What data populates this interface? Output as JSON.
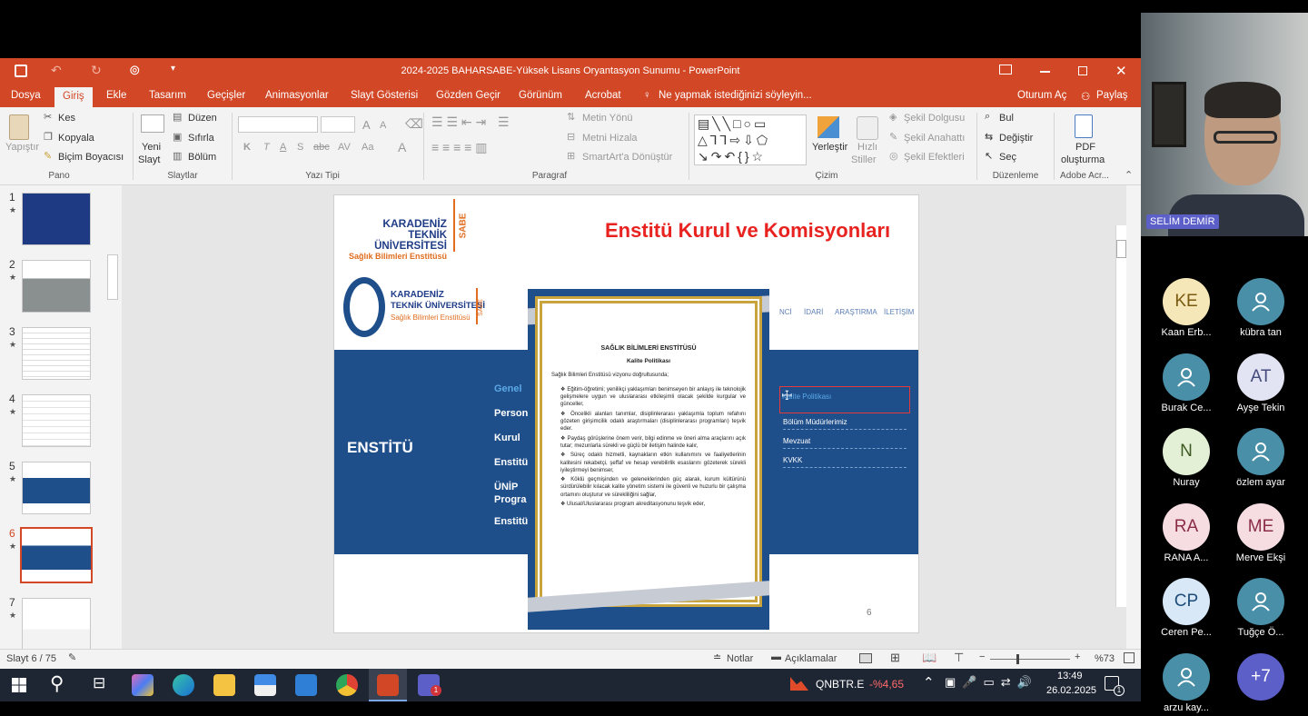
{
  "window": {
    "title": "2024-2025 BAHARSABE-Yüksek Lisans Oryantasyon Sunumu - PowerPoint"
  },
  "menu": {
    "tabs": [
      "Dosya",
      "Giriş",
      "Ekle",
      "Tasarım",
      "Geçişler",
      "Animasyonlar",
      "Slayt Gösterisi",
      "Gözden Geçir",
      "Görünüm",
      "Acrobat"
    ],
    "tell_me": "Ne yapmak istediğinizi söyleyin...",
    "sign_in": "Oturum Aç",
    "share": "Paylaş"
  },
  "ribbon": {
    "pano": {
      "label": "Pano",
      "paste": "Yapıştır",
      "cut": "Kes",
      "copy": "Kopyala",
      "format_painter": "Biçim Boyacısı"
    },
    "slaytlar": {
      "label": "Slaytlar",
      "new_slide_1": "Yeni",
      "new_slide_2": "Slayt",
      "layout": "Düzen",
      "reset": "Sıfırla",
      "section": "Bölüm"
    },
    "yazi_tipi": {
      "label": "Yazı Tipi",
      "b": "K",
      "i": "T",
      "u": "A",
      "s": "S",
      "abc": "abc",
      "av": "AV",
      "aa": "Aa",
      "a": "A",
      "grow": "A",
      "shrink": "A"
    },
    "paragraf": {
      "label": "Paragraf",
      "text_dir": "Metin Yönü",
      "align_text": "Metni Hizala",
      "smartart": "SmartArt'a Dönüştür"
    },
    "cizim": {
      "label": "Çizim",
      "arrange": "Yerleştir",
      "quick_styles_1": "Hızlı",
      "quick_styles_2": "Stiller",
      "fill": "Şekil Dolgusu",
      "outline": "Şekil Anahattı",
      "effects": "Şekil Efektleri"
    },
    "duzenleme": {
      "label": "Düzenleme",
      "find": "Bul",
      "replace": "Değiştir",
      "select": "Seç"
    },
    "adobe": {
      "label": "Adobe Acr...",
      "pdf_1": "PDF",
      "pdf_2": "oluşturma"
    }
  },
  "thumbnails": [
    "1",
    "2",
    "3",
    "4",
    "5",
    "6",
    "7"
  ],
  "slide": {
    "uni_line1": "KARADENİZ",
    "uni_line2": "TEKNİK ÜNİVERSİTESİ",
    "institute": "Sağlık Bilimleri Enstitüsü",
    "sabe": "SABE",
    "title": "Enstitü Kurul ve Komisyonları",
    "nav": [
      "NCİ",
      "İDARİ",
      "ARAŞTIRMA",
      "İLETİŞİM"
    ],
    "enstitu": "ENSTİTÜ",
    "left_menu": [
      "Genel",
      "Person",
      "Kurul",
      "Enstitü",
      "ÜNİP",
      "Progra",
      "Enstitü"
    ],
    "right_menu": [
      "Kalite Politikası",
      "Bölüm Müdürlerimiz",
      "Mevzuat",
      "KVKK"
    ],
    "page_number": "6",
    "popup": {
      "heading": "SAĞLIK BİLİMLERİ ENSTİTÜSÜ",
      "subheading": "Kalite Politikası",
      "intro": "Sağlık Bilimleri Enstitüsü vizyonu doğrultusunda;",
      "bullets": [
        "Eğitim-öğretimi; yenilikçi yaklaşımları benimseyen bir anlayış ile teknolojik gelişmelere uygun ve uluslararası etkileşimli olacak şekilde kurgular ve günceller,",
        "Öncelikli alanları tanımlar, disiplinlerarası yaklaşımla toplum refahını gözeten girişimcilik odaklı araştırmaları (disiplinlerarası programları) teşvik eder.",
        "Paydaş görüşlerine önem verir, bilgi edinme ve öneri alma araçlarını açık tutar; mezunlarla sürekli ve güçlü bir iletişim halinde kalır,",
        "Süreç odaklı hizmetli, kaynakların etkin kullanımını ve faaliyetlerinin kalitesini rekabetçi, şeffaf ve hesap verebilirlik esaslarını gözeterek sürekli iyileştirmeyi benimser,",
        "Köklü geçmişinden ve geleneklerinden güç alarak, kurum kültürünü sürdürülebilir kılacak kalite yönetim sistemi ile güvenli ve huzurlu bir çalışma ortamını oluşturur ve sürekliliğini sağlar,",
        "Ulusal/Uluslararası program akreditasyonunu teşvik eder,"
      ]
    }
  },
  "status": {
    "slide_info": "Slayt 6 / 75",
    "notes": "Notlar",
    "comments": "Açıklamalar",
    "zoom": "%73"
  },
  "taskbar": {
    "stock_name": "QNBTR.E",
    "stock_change": "-%4,65",
    "time": "13:49",
    "date": "26.02.2025",
    "teams_badge": "1",
    "notif_badge": "1"
  },
  "meeting": {
    "speaker": "SELİM DEMİR",
    "participants": [
      {
        "initials": "KE",
        "name": "Kaan Erb...",
        "color": "#f6e7b8",
        "text": "#7a5a10"
      },
      {
        "initials": "",
        "name": "kübra tan",
        "color": "#4a8fa8",
        "text": "#fff"
      },
      {
        "initials": "",
        "name": "Burak Ce...",
        "color": "#4a8fa8",
        "text": "#fff"
      },
      {
        "initials": "AT",
        "name": "Ayşe Tekin",
        "color": "#e3e4f3",
        "text": "#454a7c"
      },
      {
        "initials": "N",
        "name": "Nuray",
        "color": "#e3f0d6",
        "text": "#3d5a22"
      },
      {
        "initials": "",
        "name": "özlem ayar",
        "color": "#4a8fa8",
        "text": "#fff"
      },
      {
        "initials": "RA",
        "name": "RANA A...",
        "color": "#f6dde2",
        "text": "#8a2d45"
      },
      {
        "initials": "ME",
        "name": "Merve Ekşi",
        "color": "#f6dde2",
        "text": "#8a2d45"
      },
      {
        "initials": "CP",
        "name": "Ceren Pe...",
        "color": "#d8e8f7",
        "text": "#1f4d7a"
      },
      {
        "initials": "",
        "name": "Tuğçe Ö...",
        "color": "#4a8fa8",
        "text": "#fff"
      },
      {
        "initials": "",
        "name": "arzu kay...",
        "color": "#4a8fa8",
        "text": "#fff"
      },
      {
        "initials": "+7",
        "name": "",
        "color": "#5b5fc7",
        "text": "#fff"
      }
    ]
  }
}
